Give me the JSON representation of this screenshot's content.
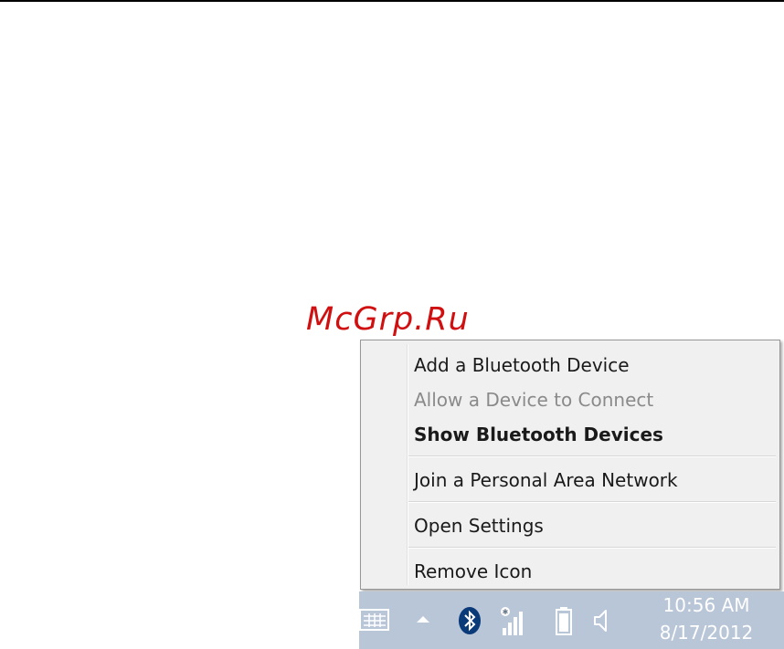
{
  "watermark": {
    "text": "McGrp.Ru"
  },
  "context_menu": {
    "items": [
      {
        "label": "Add a Bluetooth Device",
        "state": "enabled"
      },
      {
        "label": "Allow a Device to Connect",
        "state": "disabled"
      },
      {
        "label": "Show Bluetooth Devices",
        "state": "default"
      },
      {
        "label": "Join a Personal Area Network",
        "state": "enabled"
      },
      {
        "label": "Open Settings",
        "state": "enabled"
      },
      {
        "label": "Remove Icon",
        "state": "enabled"
      }
    ]
  },
  "taskbar": {
    "icons": [
      "touch-keyboard-icon",
      "show-hidden-icons-icon",
      "bluetooth-icon",
      "network-signal-icon",
      "battery-icon",
      "volume-icon"
    ],
    "clock": {
      "time": "10:56 AM",
      "date": "8/17/2012"
    }
  },
  "colors": {
    "taskbar": "#b9c6d8",
    "menu_background": "#f0f0f0",
    "watermark": "#d01010"
  }
}
